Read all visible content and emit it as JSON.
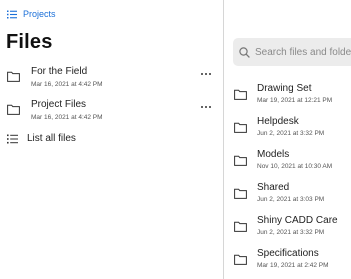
{
  "breadcrumb": {
    "label": "Projects",
    "icon": "list-icon",
    "color": "#1a6fd8"
  },
  "page_title": "Files",
  "folders_left": [
    {
      "name": "For the Field",
      "date": "Mar 16, 2021 at 4:42 PM"
    },
    {
      "name": "Project Files",
      "date": "Mar 16, 2021 at 4:42 PM"
    }
  ],
  "list_all": {
    "label": "List all files",
    "icon": "list-icon"
  },
  "search": {
    "placeholder": "Search files and folders",
    "icon": "search-icon"
  },
  "folders_right": [
    {
      "name": "Drawing Set",
      "date": "Mar 19, 2021 at 12:21 PM"
    },
    {
      "name": "Helpdesk",
      "date": "Jun 2, 2021 at 3:32 PM"
    },
    {
      "name": "Models",
      "date": "Nov 10, 2021 at 10:30 AM"
    },
    {
      "name": "Shared",
      "date": "Jun 2, 2021 at 3:03 PM"
    },
    {
      "name": "Shiny CADD Care",
      "date": "Jun 2, 2021 at 3:32 PM"
    },
    {
      "name": "Specifications",
      "date": "Mar 19, 2021 at 2:42 PM"
    }
  ]
}
